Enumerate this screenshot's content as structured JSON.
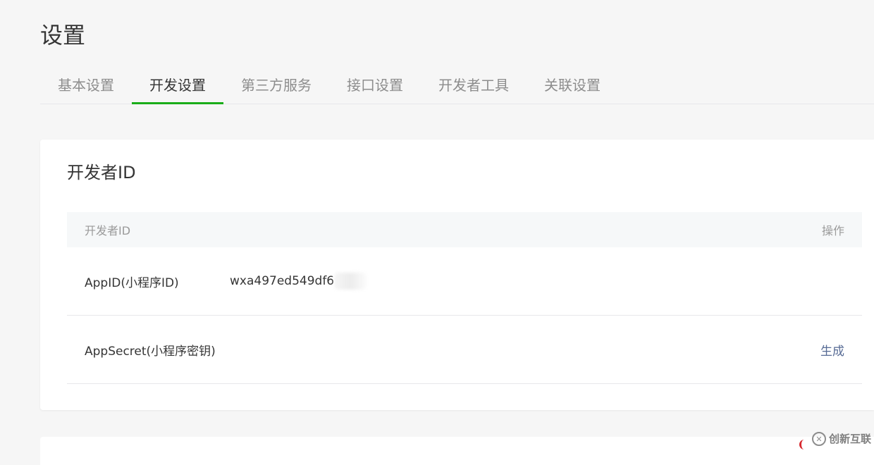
{
  "page": {
    "title": "设置"
  },
  "tabs": [
    {
      "label": "基本设置",
      "active": false
    },
    {
      "label": "开发设置",
      "active": true
    },
    {
      "label": "第三方服务",
      "active": false
    },
    {
      "label": "接口设置",
      "active": false
    },
    {
      "label": "开发者工具",
      "active": false
    },
    {
      "label": "关联设置",
      "active": false
    }
  ],
  "developer_card": {
    "title": "开发者ID",
    "table": {
      "header_left": "开发者ID",
      "header_right": "操作",
      "rows": [
        {
          "label": "AppID(小程序ID)",
          "value": "wxa497ed549df6",
          "action": ""
        },
        {
          "label": "AppSecret(小程序密钥)",
          "value": "",
          "action": "生成"
        }
      ]
    }
  },
  "watermark": {
    "icon": "cx-logo-icon",
    "text": "创新互联"
  },
  "colors": {
    "accent": "#1aad19",
    "link": "#576b95",
    "background": "#f6f6f6"
  }
}
